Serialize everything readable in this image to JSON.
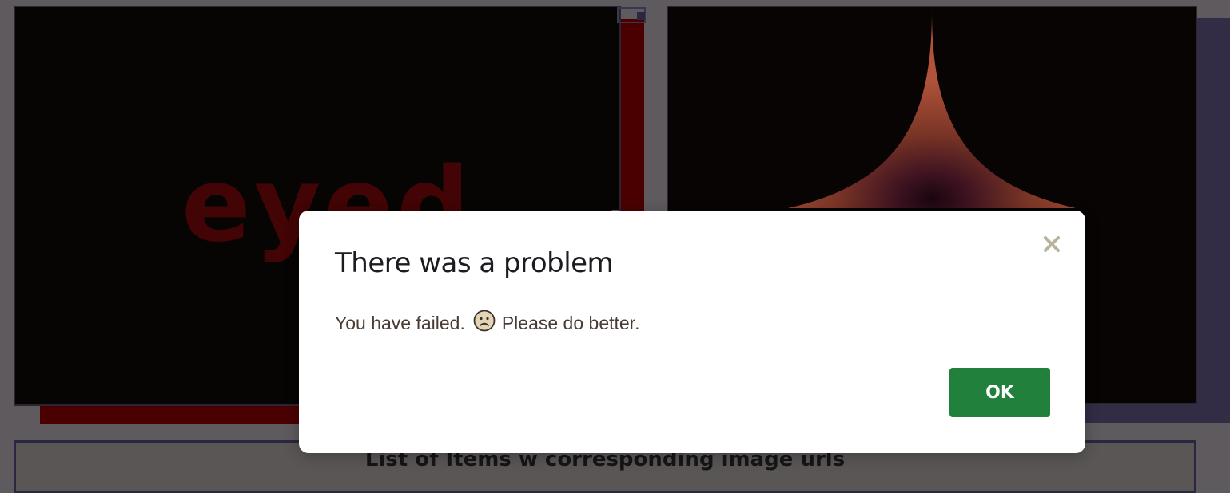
{
  "background": {
    "left_panel_text": "eyed",
    "list_heading": "List of Items w corresponding image urls"
  },
  "dialog": {
    "title": "There was a problem",
    "message_before": "You have failed.",
    "message_icon": "sad-face-emoji",
    "message_after": "Please do better.",
    "ok_label": "OK",
    "close_icon": "close-icon"
  },
  "colors": {
    "ok_button": "#21813c",
    "close_icon": "#b7b39c",
    "overlay": "#5e5a5e"
  }
}
